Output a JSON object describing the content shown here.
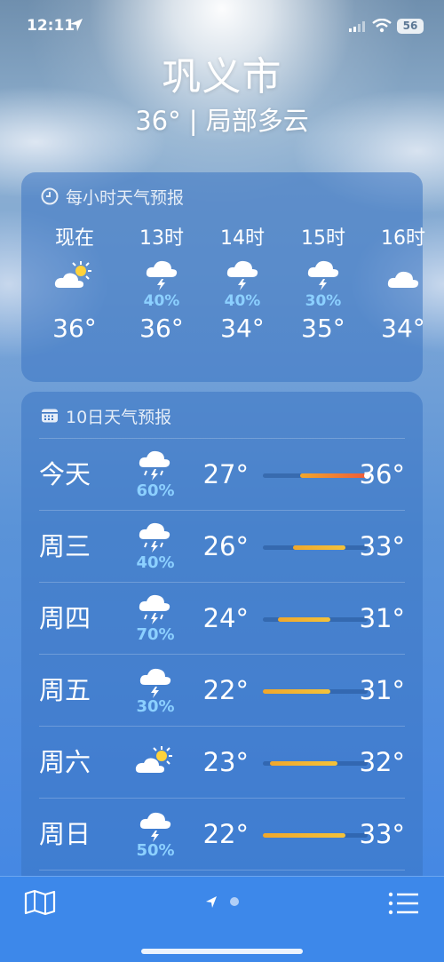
{
  "status": {
    "time": "12:11",
    "battery": "56"
  },
  "header": {
    "city": "巩义市",
    "summary": "36° | 局部多云"
  },
  "hourly": {
    "title": "每小时天气预报",
    "hours": [
      {
        "label": "现在",
        "icon": "partly-cloudy-sun-icon",
        "prob": "",
        "temp": "36°"
      },
      {
        "label": "13时",
        "icon": "thunderstorm-icon",
        "prob": "40%",
        "temp": "36°"
      },
      {
        "label": "14时",
        "icon": "thunderstorm-icon",
        "prob": "40%",
        "temp": "34°"
      },
      {
        "label": "15时",
        "icon": "thunderstorm-icon",
        "prob": "30%",
        "temp": "35°"
      },
      {
        "label": "16时",
        "icon": "cloud-icon",
        "prob": "",
        "temp": "34°"
      }
    ]
  },
  "daily": {
    "title": "10日天气预报",
    "range_low": 22,
    "range_high": 36,
    "days": [
      {
        "day": "今天",
        "icon": "thunderstorm-rain-icon",
        "prob": "60%",
        "low": "27°",
        "high": "36°",
        "low_val": 27,
        "high_val": 36,
        "current": 36
      },
      {
        "day": "周三",
        "icon": "thunderstorm-rain-icon",
        "prob": "40%",
        "low": "26°",
        "high": "33°",
        "low_val": 26,
        "high_val": 33
      },
      {
        "day": "周四",
        "icon": "thunderstorm-rain-icon",
        "prob": "70%",
        "low": "24°",
        "high": "31°",
        "low_val": 24,
        "high_val": 31
      },
      {
        "day": "周五",
        "icon": "thunderstorm-icon",
        "prob": "30%",
        "low": "22°",
        "high": "31°",
        "low_val": 22,
        "high_val": 31
      },
      {
        "day": "周六",
        "icon": "partly-cloudy-sun-icon",
        "prob": "",
        "low": "23°",
        "high": "32°",
        "low_val": 23,
        "high_val": 32
      },
      {
        "day": "周日",
        "icon": "thunderstorm-icon",
        "prob": "50%",
        "low": "22°",
        "high": "33°",
        "low_val": 22,
        "high_val": 33
      }
    ]
  },
  "colors": {
    "precip": "#8cd0ff",
    "bar_hot": "#ef5b3a",
    "bar_warm": "#f0a72c"
  }
}
